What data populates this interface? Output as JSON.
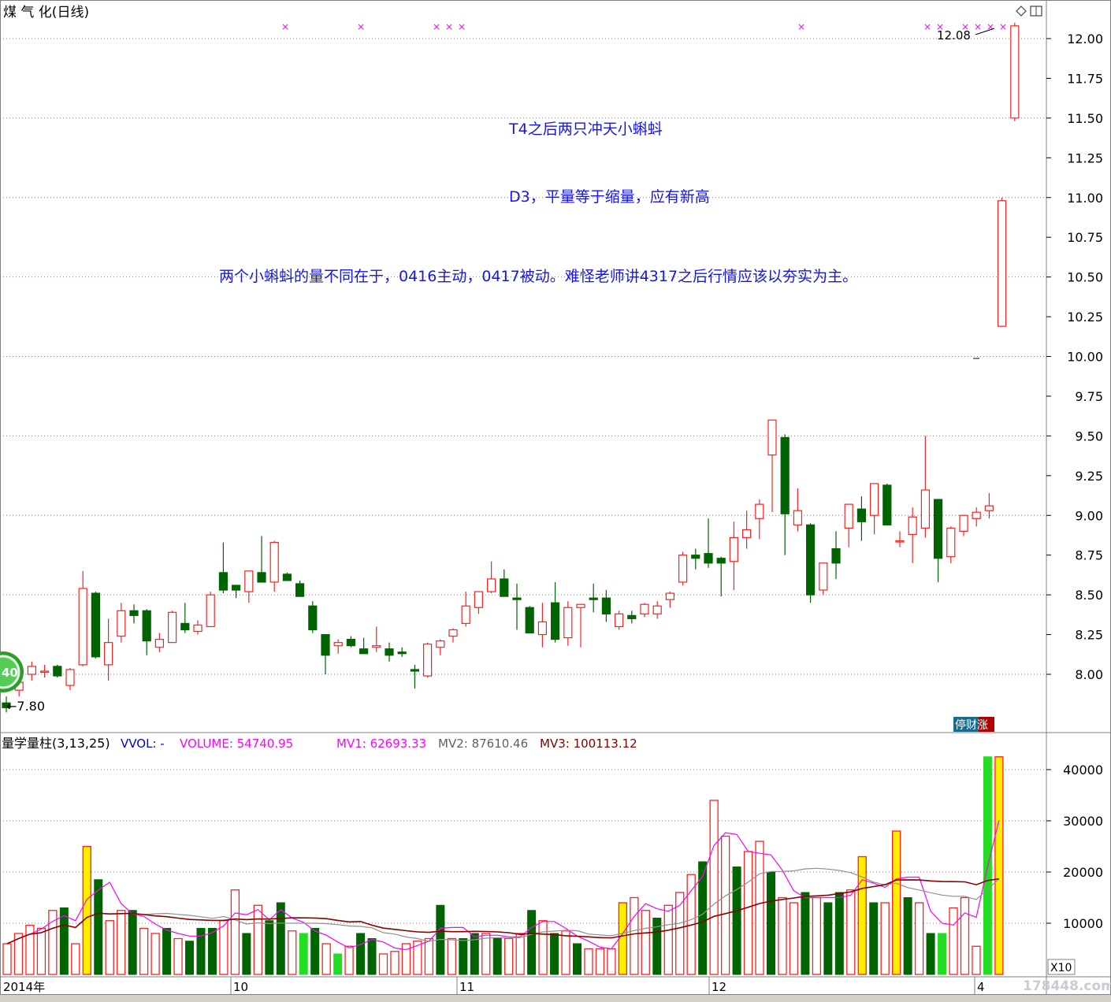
{
  "header": {
    "title": "煤 气 化(日线)",
    "corner_icons": [
      "diamond-icon",
      "window-icon"
    ]
  },
  "price_axis": {
    "ticks": [
      "12.00",
      "11.75",
      "11.50",
      "11.25",
      "11.00",
      "10.75",
      "10.50",
      "10.25",
      "10.00",
      "9.75",
      "9.50",
      "9.25",
      "9.00",
      "8.75",
      "8.50",
      "8.25",
      "8.00"
    ],
    "range": [
      7.75,
      12.2
    ]
  },
  "markers": {
    "high_label": "12.08",
    "low_label": "7.80",
    "badge_text": "40",
    "stop_label": "停财涨"
  },
  "annotations": [
    {
      "text": "T4之后两只冲天小蝌蚪"
    },
    {
      "text": "D3，平量等于缩量，应有新高"
    },
    {
      "text": "两个小蝌蚪的量不同在于，0416主动，0417被动。难怪老师讲4317之后行情应该以夯实为主。"
    }
  ],
  "volume_panel": {
    "title": "量学量柱(3,13,25)",
    "legend": [
      {
        "text": "VVOL: -",
        "color": "#0000cc"
      },
      {
        "text": "VOLUME: 54740.95",
        "color": "#ff00ff"
      },
      {
        "text": "MV1: 62693.33",
        "color": "#ff00ff"
      },
      {
        "text": "MV2: 87610.46",
        "color": "#606060"
      },
      {
        "text": "MV3: 100113.12",
        "color": "#800000"
      }
    ],
    "axis_ticks": [
      "40000",
      "30000",
      "20000",
      "10000"
    ],
    "axis_unit": "X10",
    "ylim": [
      0,
      43000
    ]
  },
  "date_axis": {
    "labels": [
      "2014年",
      "10",
      "11",
      "12",
      "4"
    ]
  },
  "watermark": "178448.com",
  "colors": {
    "up": "#ff2020",
    "down": "#006400",
    "grid": "#808080",
    "yellow": "#ffee00",
    "bright_green": "#22dd22",
    "annotation": "#1515ee"
  },
  "chart_data": {
    "type": "candlestick",
    "candles": [
      [
        7.82,
        7.86,
        7.76,
        7.79
      ],
      [
        7.9,
        7.98,
        7.86,
        7.95
      ],
      [
        8.0,
        8.08,
        7.96,
        8.05
      ],
      [
        8.02,
        8.06,
        7.98,
        8.02
      ],
      [
        8.05,
        8.06,
        7.98,
        7.99
      ],
      [
        7.93,
        8.04,
        7.9,
        8.03
      ],
      [
        8.06,
        8.65,
        8.05,
        8.54
      ],
      [
        8.51,
        8.52,
        8.1,
        8.11
      ],
      [
        8.06,
        8.35,
        7.96,
        8.2
      ],
      [
        8.24,
        8.45,
        8.2,
        8.4
      ],
      [
        8.4,
        8.44,
        8.32,
        8.37
      ],
      [
        8.4,
        8.41,
        8.12,
        8.21
      ],
      [
        8.17,
        8.26,
        8.14,
        8.22
      ],
      [
        8.2,
        8.4,
        8.2,
        8.39
      ],
      [
        8.32,
        8.45,
        8.26,
        8.28
      ],
      [
        8.27,
        8.34,
        8.25,
        8.31
      ],
      [
        8.3,
        8.52,
        8.3,
        8.5
      ],
      [
        8.64,
        8.83,
        8.51,
        8.53
      ],
      [
        8.56,
        8.56,
        8.48,
        8.53
      ],
      [
        8.52,
        8.65,
        8.45,
        8.65
      ],
      [
        8.64,
        8.87,
        8.61,
        8.58
      ],
      [
        8.58,
        8.84,
        8.52,
        8.83
      ],
      [
        8.63,
        8.64,
        8.6,
        8.59
      ],
      [
        8.57,
        8.59,
        8.49,
        8.49
      ],
      [
        8.43,
        8.46,
        8.26,
        8.28
      ],
      [
        8.25,
        8.25,
        8.0,
        8.12
      ],
      [
        8.18,
        8.22,
        8.13,
        8.2
      ],
      [
        8.22,
        8.24,
        8.17,
        8.18
      ],
      [
        8.16,
        8.23,
        8.16,
        8.13
      ],
      [
        8.17,
        8.3,
        8.14,
        8.18
      ],
      [
        8.16,
        8.2,
        8.08,
        8.12
      ],
      [
        8.14,
        8.17,
        8.11,
        8.13
      ],
      [
        8.03,
        8.06,
        7.91,
        8.02
      ],
      [
        7.99,
        8.2,
        7.98,
        8.19
      ],
      [
        8.17,
        8.22,
        8.12,
        8.21
      ],
      [
        8.24,
        8.29,
        8.2,
        8.28
      ],
      [
        8.32,
        8.52,
        8.3,
        8.43
      ],
      [
        8.42,
        8.52,
        8.38,
        8.52
      ],
      [
        8.52,
        8.71,
        8.51,
        8.6
      ],
      [
        8.6,
        8.66,
        8.49,
        8.49
      ],
      [
        8.48,
        8.57,
        8.28,
        8.47
      ],
      [
        8.42,
        8.43,
        8.27,
        8.26
      ],
      [
        8.25,
        8.45,
        8.17,
        8.33
      ],
      [
        8.45,
        8.58,
        8.2,
        8.22
      ],
      [
        8.23,
        8.46,
        8.18,
        8.42
      ],
      [
        8.42,
        8.44,
        8.17,
        8.44
      ],
      [
        8.48,
        8.57,
        8.39,
        8.47
      ],
      [
        8.48,
        8.53,
        8.33,
        8.38
      ],
      [
        8.3,
        8.4,
        8.28,
        8.38
      ],
      [
        8.37,
        8.4,
        8.32,
        8.35
      ],
      [
        8.38,
        8.45,
        8.36,
        8.44
      ],
      [
        8.38,
        8.46,
        8.35,
        8.43
      ],
      [
        8.47,
        8.52,
        8.42,
        8.51
      ],
      [
        8.58,
        8.77,
        8.56,
        8.75
      ],
      [
        8.75,
        8.79,
        8.66,
        8.73
      ],
      [
        8.76,
        8.98,
        8.67,
        8.7
      ],
      [
        8.73,
        8.74,
        8.49,
        8.7
      ],
      [
        8.71,
        8.96,
        8.53,
        8.86
      ],
      [
        8.86,
        9.03,
        8.79,
        8.91
      ],
      [
        8.98,
        9.1,
        8.85,
        9.07
      ],
      [
        9.38,
        9.58,
        9.02,
        9.6
      ],
      [
        9.49,
        9.51,
        8.75,
        9.01
      ],
      [
        8.94,
        9.17,
        8.9,
        9.03
      ],
      [
        8.94,
        8.95,
        8.45,
        8.5
      ],
      [
        8.53,
        8.62,
        8.5,
        8.7
      ],
      [
        8.79,
        8.9,
        8.6,
        8.7
      ],
      [
        8.92,
        9.0,
        8.8,
        9.07
      ],
      [
        9.04,
        9.12,
        8.84,
        8.96
      ],
      [
        9.0,
        9.2,
        8.88,
        9.2
      ],
      [
        9.19,
        9.2,
        8.94,
        8.94
      ],
      [
        8.84,
        8.9,
        8.8,
        8.84
      ],
      [
        8.88,
        9.05,
        8.7,
        8.99
      ],
      [
        8.92,
        9.5,
        8.86,
        9.16
      ],
      [
        9.1,
        9.08,
        8.58,
        8.73
      ],
      [
        8.74,
        8.93,
        8.7,
        8.92
      ],
      [
        8.9,
        9.0,
        8.87,
        9.0
      ],
      [
        8.98,
        9.05,
        8.93,
        9.02
      ],
      [
        9.03,
        9.14,
        8.98,
        9.06
      ],
      [
        10.19,
        11.0,
        10.19,
        10.98
      ],
      [
        11.5,
        12.1,
        11.48,
        12.08
      ]
    ],
    "volumes": [
      6,
      8,
      9.6,
      9,
      12.5,
      13,
      6,
      25,
      18.5,
      10.5,
      12.5,
      12.5,
      9,
      8,
      9,
      7,
      6.5,
      9,
      9,
      10.5,
      16.5,
      8,
      13.5,
      10.5,
      14,
      8.5,
      8,
      9,
      6,
      4,
      5.5,
      8,
      7,
      4,
      4.5,
      6,
      6.5,
      7,
      13.5,
      7,
      7,
      8,
      8,
      7,
      7,
      8,
      12.5,
      10.5,
      8,
      8.5,
      6,
      5,
      5,
      5,
      14,
      15,
      12.5,
      11,
      13.5,
      16,
      19.5,
      22,
      34,
      27,
      21,
      24,
      26,
      20,
      15,
      14,
      16,
      15,
      14,
      16,
      16.5,
      23,
      14,
      14,
      28,
      15,
      14,
      8,
      8,
      13,
      15,
      5.5,
      42.5,
      42.5
    ],
    "volume_colors": [
      "r",
      "r",
      "r",
      "r",
      "r",
      "g",
      "r",
      "y",
      "g",
      "r",
      "r",
      "g",
      "r",
      "r",
      "g",
      "r",
      "g",
      "g",
      "g",
      "r",
      "r",
      "g",
      "r",
      "g",
      "g",
      "r",
      "G",
      "g",
      "r",
      "G",
      "r",
      "g",
      "g",
      "r",
      "r",
      "r",
      "r",
      "r",
      "g",
      "r",
      "g",
      "g",
      "r",
      "g",
      "r",
      "r",
      "g",
      "r",
      "g",
      "r",
      "g",
      "r",
      "r",
      "r",
      "y",
      "r",
      "r",
      "g",
      "r",
      "r",
      "r",
      "g",
      "r",
      "r",
      "g",
      "r",
      "r",
      "g",
      "r",
      "r",
      "g",
      "r",
      "g",
      "g",
      "r",
      "y",
      "g",
      "r",
      "y",
      "g",
      "r",
      "g",
      "G",
      "r",
      "r",
      "r",
      "G",
      "y",
      "r"
    ]
  }
}
